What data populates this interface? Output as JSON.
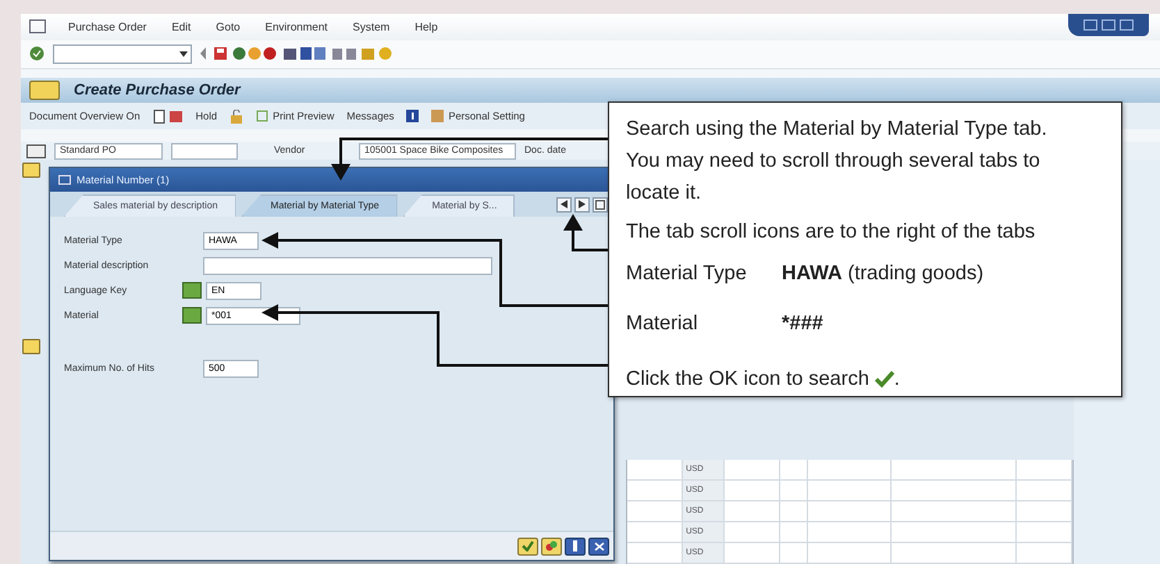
{
  "menu_bar": [
    "Purchase Order",
    "Edit",
    "Goto",
    "Environment",
    "System",
    "Help"
  ],
  "screen_title": "Create Purchase Order",
  "app_toolbar": [
    {
      "label": "Document Overview On"
    },
    {
      "label": "Hold"
    },
    {
      "label": "Print Preview"
    },
    {
      "label": "Messages"
    },
    {
      "label": "Personal Setting"
    }
  ],
  "header": {
    "doc_type": "Standard PO",
    "vendor_label": "Vendor",
    "vendor": "105001 Space Bike Composites",
    "doc_date_label": "Doc. date"
  },
  "table": {
    "rows": [
      {
        "currency": "USD"
      },
      {
        "currency": "USD"
      },
      {
        "currency": "USD"
      },
      {
        "currency": "USD"
      },
      {
        "currency": "USD"
      }
    ]
  },
  "dialog": {
    "title": "Material Number (1)",
    "tabs": [
      {
        "label": "Sales material by description",
        "selected": false
      },
      {
        "label": "Material by Material Type",
        "selected": true
      },
      {
        "label": "Material by S...",
        "selected": false
      }
    ],
    "fields": [
      {
        "kind": "plain",
        "label": "Material Type",
        "value": "HAWA"
      },
      {
        "kind": "wide",
        "label": "Material description"
      },
      {
        "kind": "option",
        "label": "Language Key",
        "value": "EN"
      },
      {
        "kind": "range",
        "label": "Material",
        "value": "*001"
      },
      {
        "kind": "spaced",
        "label": "Maximum No. of Hits",
        "value": "500"
      }
    ]
  },
  "callout": {
    "paragraphs": [
      "Search using the Material by Material Type tab. You may need to scroll through several tabs to locate it.",
      "The tab scroll icons are to the right of the tabs"
    ],
    "values": [
      {
        "label": "Material Type",
        "value": "HAWA",
        "note": "(trading goods)"
      },
      {
        "label": "Material",
        "value": "*###"
      }
    ],
    "closing": {
      "text": "Click the OK icon to search",
      "end": "."
    }
  }
}
